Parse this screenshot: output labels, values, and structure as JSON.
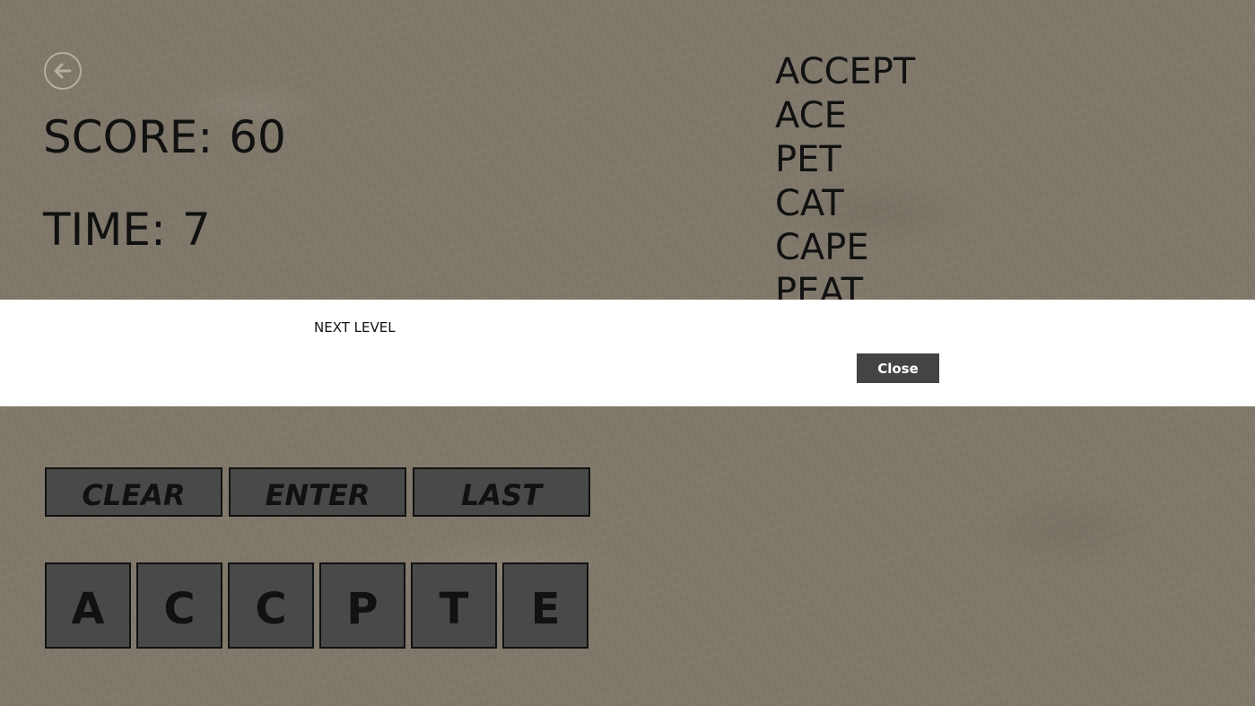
{
  "header": {
    "back_icon": "back-arrow-icon"
  },
  "stats": {
    "score_label": "SCORE:",
    "score_value": "60",
    "time_label": "TIME:",
    "time_value": "7"
  },
  "found_words": [
    "ACCEPT",
    "ACE",
    "PET",
    "CAT",
    "CAPE",
    "PEAT"
  ],
  "dialog": {
    "message": "NEXT LEVEL",
    "close_label": "Close"
  },
  "controls": {
    "clear_label": "CLEAR",
    "enter_label": "ENTER",
    "last_label": "LAST"
  },
  "tiles": [
    "A",
    "C",
    "C",
    "P",
    "T",
    "E"
  ],
  "colors": {
    "background": "#80786a",
    "tile": "#494949",
    "dialog": "#ffffff",
    "close_button": "#444444"
  }
}
